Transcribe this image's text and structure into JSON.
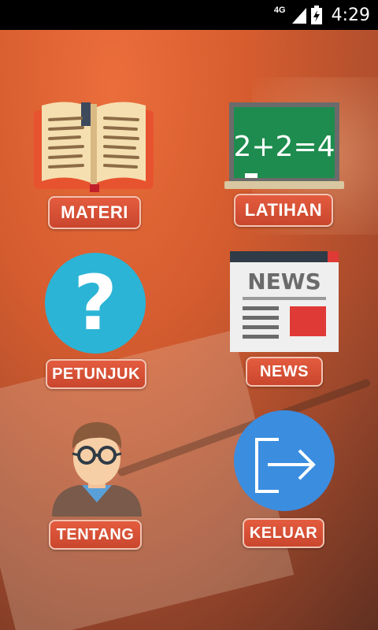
{
  "status_bar": {
    "network": "4G",
    "time": "4:29",
    "icons": [
      "signal-icon",
      "battery-icon"
    ]
  },
  "menu": {
    "materi": {
      "label": "MATERI",
      "icon": "book-icon"
    },
    "latihan": {
      "label": "LATIHAN",
      "icon": "chalkboard-icon",
      "board_text": "2+2=4"
    },
    "petunjuk": {
      "label": "PETUNJUK",
      "icon": "question-icon",
      "glyph": "?"
    },
    "news": {
      "label": "NEWS",
      "icon": "newspaper-icon",
      "paper_text": "NEWS"
    },
    "tentang": {
      "label": "TENTANG",
      "icon": "person-icon"
    },
    "keluar": {
      "label": "KELUAR",
      "icon": "exit-icon"
    }
  },
  "colors": {
    "button": "#d9503a",
    "question_circle": "#2bb4d6",
    "exit_circle": "#3b8de0",
    "chalkboard": "#1e8c4e",
    "book_cover": "#e8532f"
  }
}
